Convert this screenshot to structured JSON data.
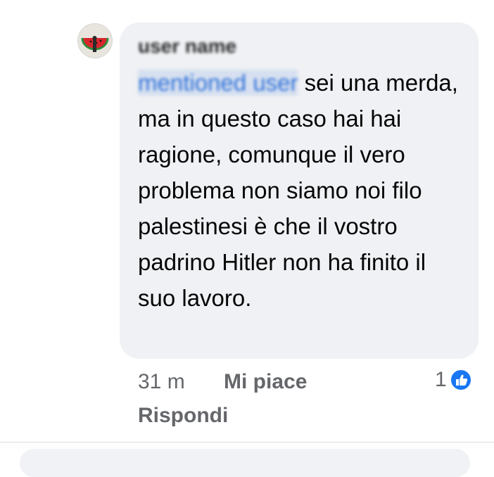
{
  "comment": {
    "author": "user name",
    "mention": "mentioned user",
    "text": "sei una merda, ma in questo caso hai hai ragione, comunque il vero problema non siamo noi filo palestinesi è che il vostro padrino Hitler non ha finito il suo lavoro.",
    "time": "31 m",
    "like_label": "Mi piace",
    "reply_label": "Rispondi",
    "reaction_count": "1",
    "reaction_icon": "like-icon",
    "accent_color": "#1877f2"
  }
}
